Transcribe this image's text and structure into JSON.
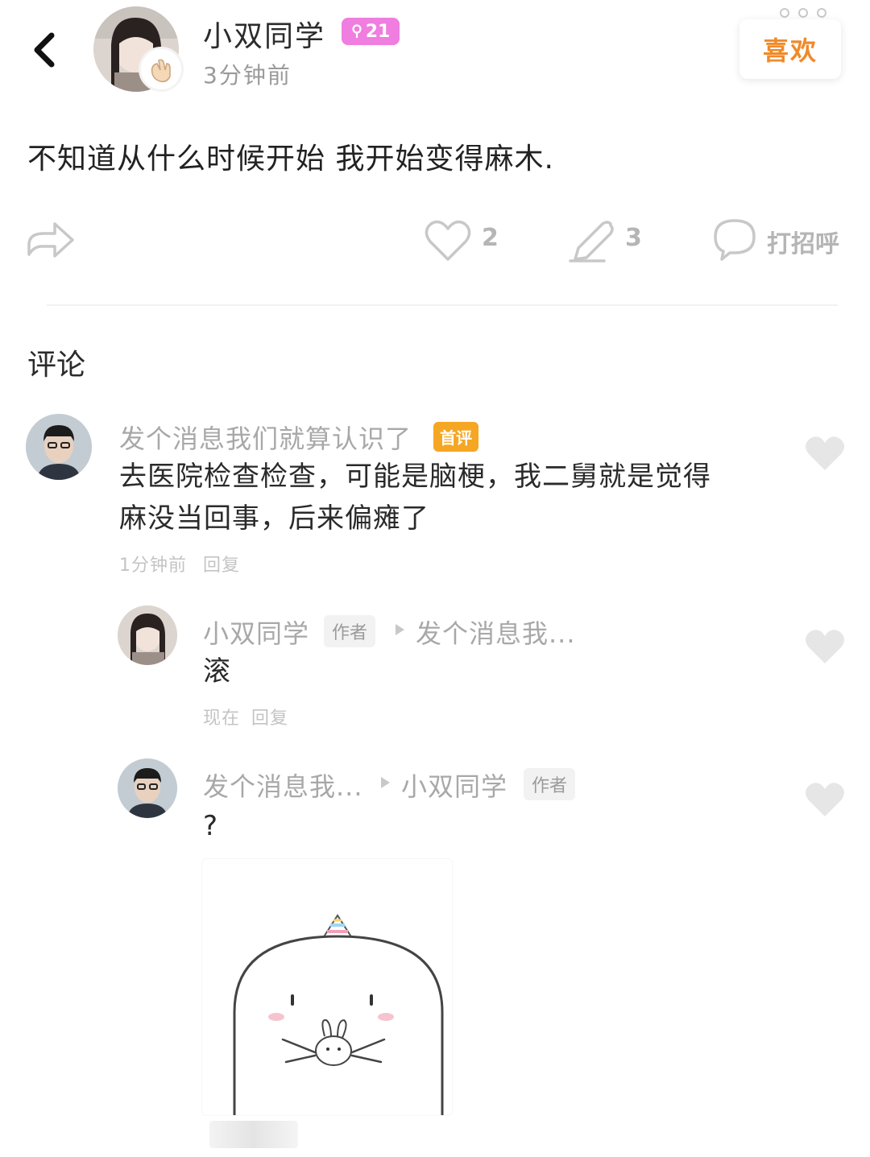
{
  "header": {
    "back_icon": "chevron-left-icon",
    "username": "小双同学",
    "level_badge": "21",
    "time": "3分钟前",
    "like_button": "喜欢"
  },
  "post": {
    "text": "不知道从什么时候开始 我开始变得麻木."
  },
  "actions": {
    "share_icon": "share-icon",
    "likes_count": "2",
    "comments_count": "3",
    "greet_label": "打招呼"
  },
  "comments_section": {
    "title": "评论",
    "comments": [
      {
        "author": "发个消息我们就算认识了",
        "tag": "首评",
        "text_line1": "去医院检查检查，可能是脑梗，我二舅就是觉得",
        "text_line2": "麻没当回事，后来偏瘫了",
        "time": "1分钟前",
        "reply": "回复"
      },
      {
        "author": "小双同学",
        "tag": "作者",
        "reply_to": "发个消息我...",
        "text": "滚",
        "time": "现在",
        "reply": "回复"
      },
      {
        "author": "发个消息我...",
        "reply_to": "小双同学",
        "tag": "作者",
        "text": "?"
      }
    ]
  },
  "colors": {
    "accent_orange": "#f08a2a",
    "level_pink": "#f07de0",
    "first_tag": "#f5a623"
  }
}
